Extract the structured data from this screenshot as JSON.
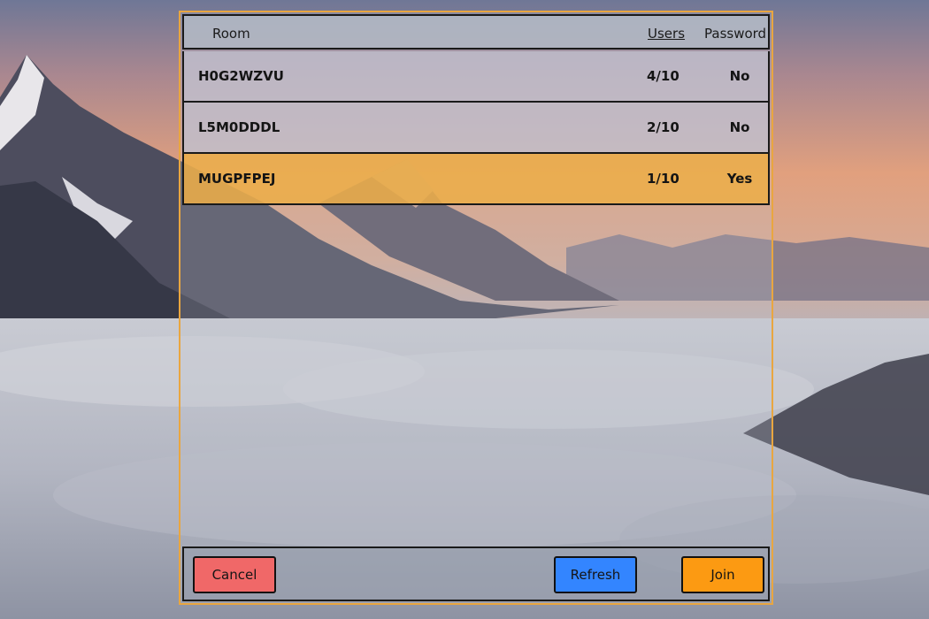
{
  "table": {
    "headers": {
      "room": "Room",
      "users": "Users",
      "password": "Password"
    },
    "rows": [
      {
        "name": "H0G2WZVU",
        "users": "4/10",
        "password": "No",
        "selected": false
      },
      {
        "name": "L5M0DDDL",
        "users": "2/10",
        "password": "No",
        "selected": false
      },
      {
        "name": "MUGPFPEJ",
        "users": "1/10",
        "password": "Yes",
        "selected": true
      }
    ]
  },
  "buttons": {
    "cancel": "Cancel",
    "refresh": "Refresh",
    "join": "Join"
  },
  "colors": {
    "panel_border": "#e9a640",
    "selected_row": "#ecad49",
    "cancel_button": "#f06868",
    "refresh_button": "#3385ff",
    "join_button": "#fc9a12"
  }
}
